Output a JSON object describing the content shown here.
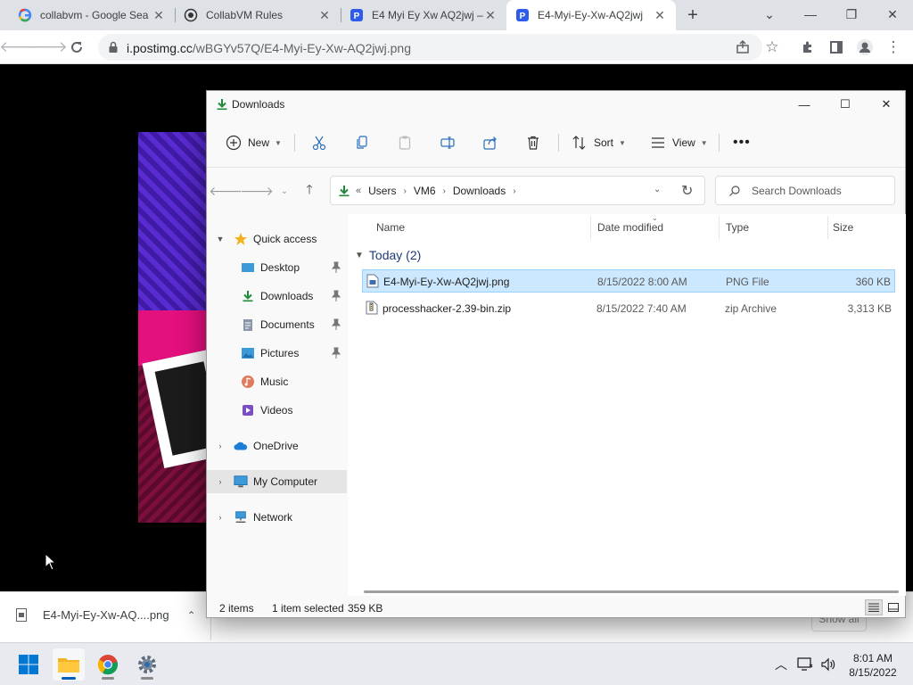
{
  "browser": {
    "tabs": [
      {
        "title": "collabvm - Google Sea",
        "icon": "google-icon"
      },
      {
        "title": "CollabVM Rules",
        "icon": "collabvm-icon"
      },
      {
        "title": "E4 Myi Ey Xw AQ2jwj –",
        "icon": "postimg-icon"
      },
      {
        "title": "E4-Myi-Ey-Xw-AQ2jwj",
        "icon": "postimg-icon"
      }
    ],
    "url_host": "i.postimg.cc",
    "url_path": "/wBGYv57Q/E4-Myi-Ey-Xw-AQ2jwj.png"
  },
  "download_bar": {
    "filename": "E4-Myi-Ey-Xw-AQ....png",
    "show_all": "Show all"
  },
  "explorer": {
    "title": "Downloads",
    "toolbar": {
      "new": "New",
      "sort": "Sort",
      "view": "View"
    },
    "breadcrumbs": [
      "Users",
      "VM6",
      "Downloads"
    ],
    "search_placeholder": "Search Downloads",
    "nav": {
      "quick_access": "Quick access",
      "desktop": "Desktop",
      "downloads": "Downloads",
      "documents": "Documents",
      "pictures": "Pictures",
      "music": "Music",
      "videos": "Videos",
      "onedrive": "OneDrive",
      "my_computer": "My Computer",
      "network": "Network"
    },
    "columns": {
      "name": "Name",
      "date": "Date modified",
      "type": "Type",
      "size": "Size"
    },
    "group": "Today (2)",
    "files": [
      {
        "name": "E4-Myi-Ey-Xw-AQ2jwj.png",
        "date": "8/15/2022 8:00 AM",
        "type": "PNG File",
        "size": "360 KB"
      },
      {
        "name": "processhacker-2.39-bin.zip",
        "date": "8/15/2022 7:40 AM",
        "type": "zip Archive",
        "size": "3,313 KB"
      }
    ],
    "status": {
      "items": "2 items",
      "selected": "1 item selected",
      "selected_size": "359 KB"
    }
  },
  "taskbar": {
    "time": "8:01 AM",
    "date": "8/15/2022"
  },
  "colors": {
    "accent": "#005fb8",
    "selection": "#cce8ff",
    "downloads_green": "#1f8a3a"
  }
}
